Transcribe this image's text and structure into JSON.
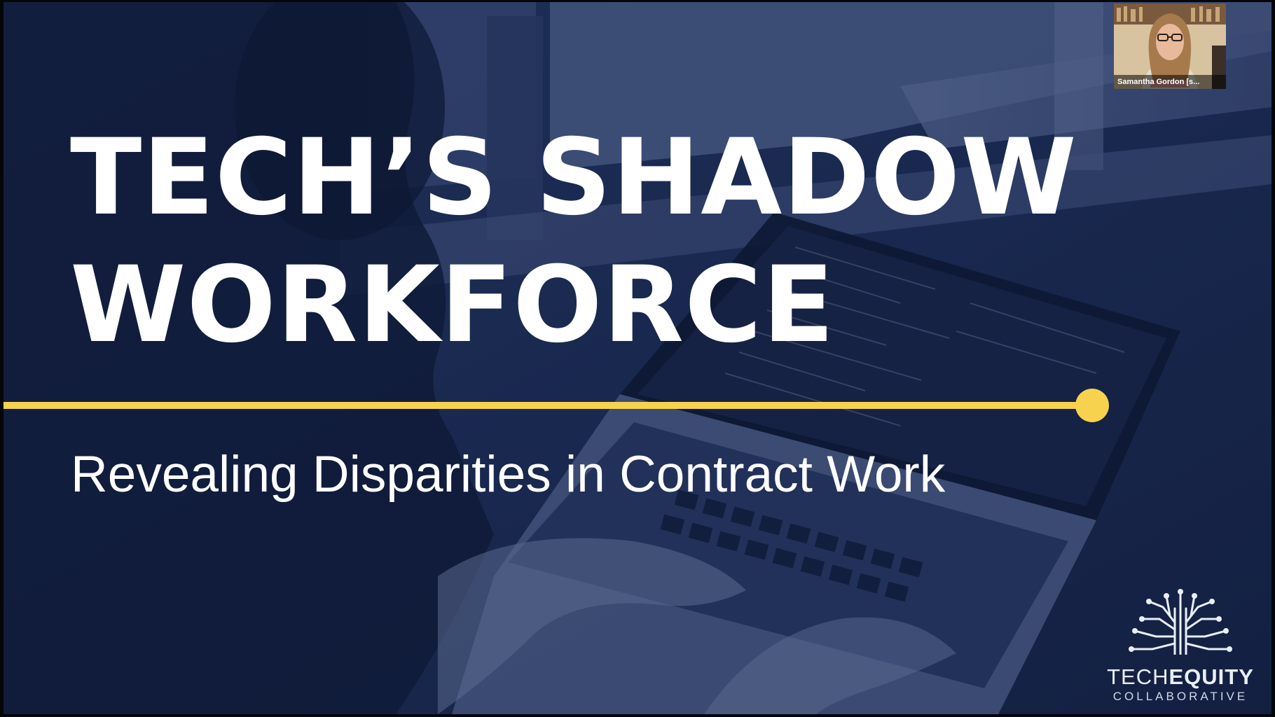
{
  "slide": {
    "title_line1": "TECH’S SHADOW",
    "title_line2": "WORKFORCE",
    "subtitle": "Revealing Disparities in Contract Work",
    "accent_color": "#f7d24f",
    "background_color": "#1b2a4e",
    "background_image": "person-typing-on-laptop"
  },
  "logo": {
    "name_light": "TECH",
    "name_bold": "EQUITY",
    "subname": "COLLABORATIVE",
    "icon": "circuit-tree-icon"
  },
  "participant": {
    "name": "Samantha Gordon [s...",
    "icon": "video-thumbnail"
  }
}
